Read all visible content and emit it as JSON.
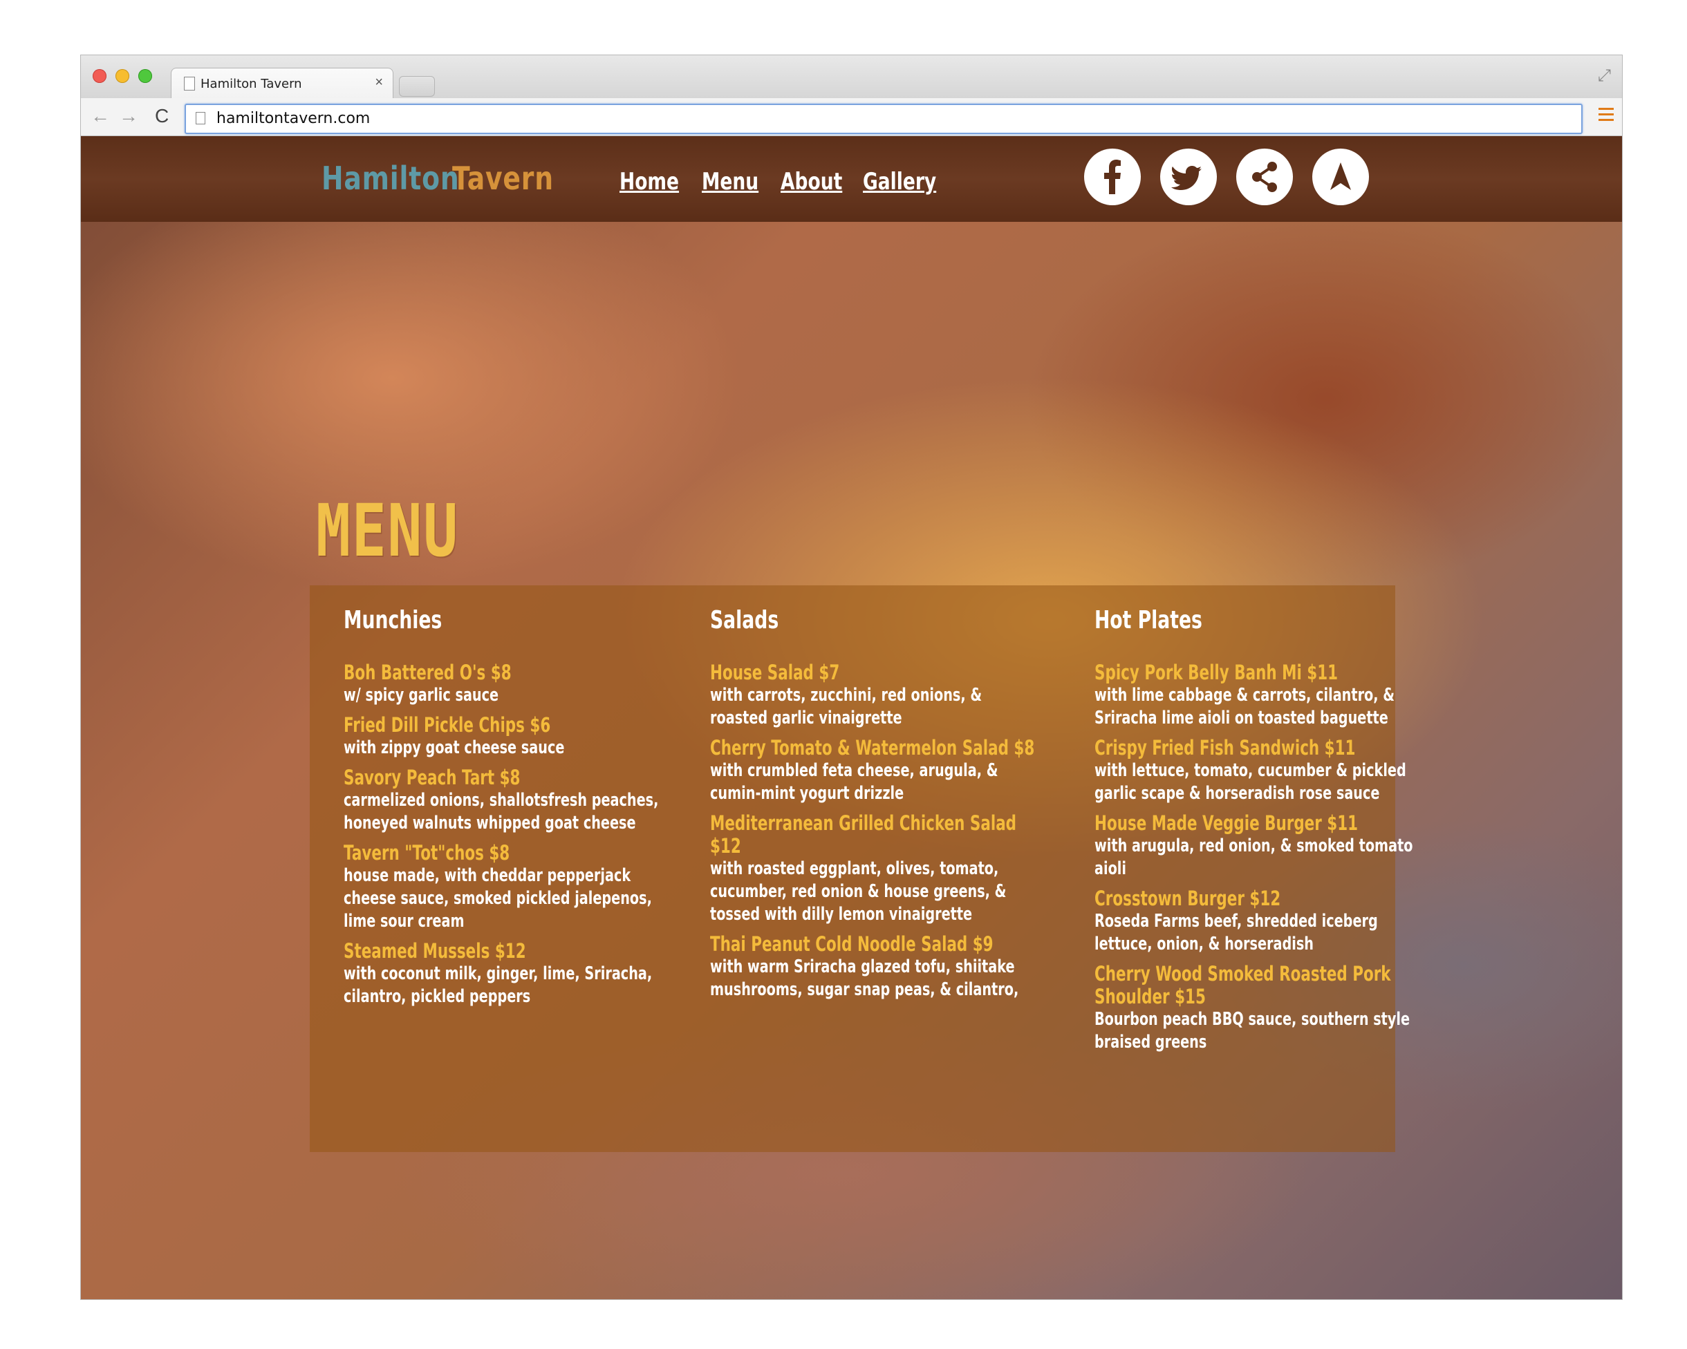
{
  "browser": {
    "tab_title": "Hamilton Tavern",
    "tab_close": "×",
    "url": "hamiltontavern.com",
    "back_glyph": "←",
    "forward_glyph": "→",
    "reload_glyph": "C",
    "fullscreen_glyph": "⤢"
  },
  "header": {
    "logo_part1": "Hamilton",
    "logo_part2": "Tavern",
    "nav": [
      "Home",
      "Menu",
      "About",
      "Gallery"
    ],
    "social_icons": [
      "facebook-icon",
      "twitter-icon",
      "share-icon",
      "navigation-arrow-icon"
    ],
    "colors": {
      "logo_part1": "#5e9aa6",
      "logo_part2": "#d6923a",
      "header_bg": "#5c2f19"
    }
  },
  "page": {
    "title": "MENU",
    "accent_color": "#f4bb3b"
  },
  "menu": {
    "columns": [
      {
        "heading": "Munchies",
        "items": [
          {
            "name": "Boh Battered O's $8",
            "desc": "w/ spicy garlic sauce"
          },
          {
            "name": "Fried Dill Pickle Chips $6",
            "desc": "with zippy goat cheese sauce"
          },
          {
            "name": "Savory Peach Tart $8",
            "desc": "carmelized onions, shallotsfresh peaches, honeyed walnuts whipped goat cheese"
          },
          {
            "name": "Tavern \"Tot\"chos $8",
            "desc": "house made, with cheddar pepperjack cheese sauce, smoked pickled jalepenos, lime sour cream"
          },
          {
            "name": "Steamed Mussels $12",
            "desc": "with coconut milk, ginger, lime, Sriracha, cilantro, pickled peppers"
          }
        ]
      },
      {
        "heading": "Salads",
        "items": [
          {
            "name": "House Salad $7",
            "desc": "with carrots, zucchini, red onions, & roasted garlic vinaigrette"
          },
          {
            "name": "Cherry Tomato & Watermelon Salad $8",
            "desc": "with crumbled feta cheese, arugula, & cumin-mint yogurt drizzle"
          },
          {
            "name": "Mediterranean Grilled Chicken Salad $12",
            "desc": "with roasted eggplant, olives, tomato, cucumber, red onion & house greens, & tossed with dilly lemon vinaigrette"
          },
          {
            "name": "Thai Peanut Cold Noodle Salad $9",
            "desc": "with warm Sriracha glazed tofu, shiitake mushrooms, sugar snap peas, & cilantro,"
          }
        ]
      },
      {
        "heading": "Hot Plates",
        "items": [
          {
            "name": "Spicy Pork Belly Banh Mi $11",
            "desc": "with lime cabbage & carrots, cilantro, & Sriracha lime aioli on toasted baguette"
          },
          {
            "name": "Crispy Fried Fish Sandwich $11",
            "desc": "with lettuce, tomato, cucumber & pickled garlic scape & horseradish rose sauce"
          },
          {
            "name": "House Made Veggie Burger $11",
            "desc": "with arugula, red onion, & smoked tomato aioli"
          },
          {
            "name": "Crosstown Burger $12",
            "desc": "Roseda Farms beef, shredded iceberg lettuce, onion, & horseradish"
          },
          {
            "name": "Cherry Wood Smoked Roasted Pork Shoulder $15",
            "desc": "Bourbon peach BBQ sauce, southern style braised greens"
          }
        ]
      }
    ]
  }
}
